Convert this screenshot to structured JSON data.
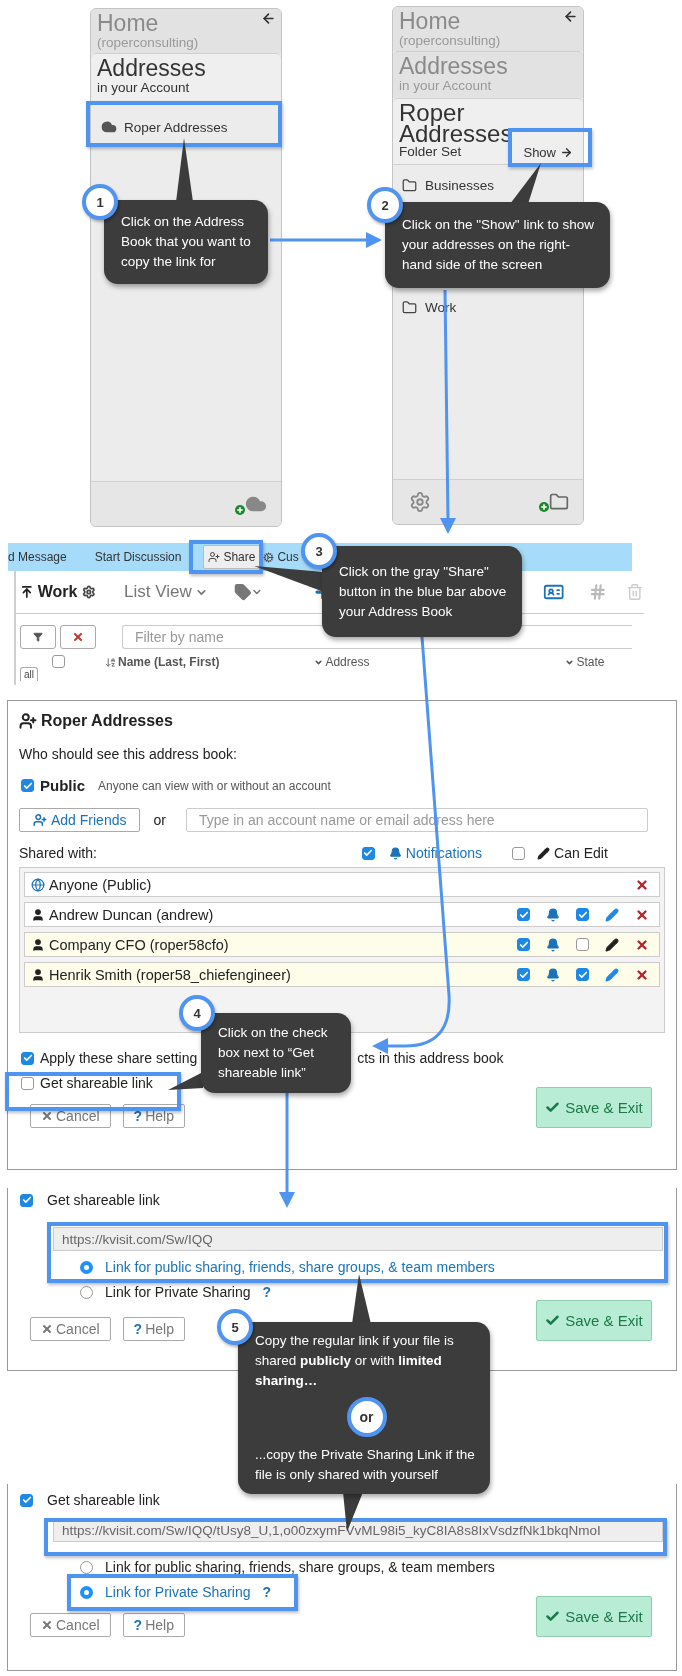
{
  "left_panel": {
    "home": {
      "title": "Home",
      "subtitle": "(roperconsulting)"
    },
    "account": {
      "title": "Addresses",
      "subtitle": "in your Account",
      "active": true
    },
    "items": [
      {
        "label": "Roper Addresses"
      }
    ]
  },
  "right_panel": {
    "home": {
      "title": "Home",
      "subtitle": "(roperconsulting)"
    },
    "account": {
      "title": "Addresses",
      "subtitle": "in your Account",
      "active": false
    },
    "folder_set": {
      "title": "Roper Addresses",
      "subtitle": "Folder Set",
      "show_link": "Show"
    },
    "folders": [
      {
        "label": "Businesses"
      },
      {
        "label": "Work"
      }
    ]
  },
  "app_strip": {
    "menu": [
      {
        "label": "d Message",
        "kind": "link"
      },
      {
        "label": "Start Discussion",
        "kind": "link"
      },
      {
        "label": "Share",
        "kind": "button"
      },
      {
        "label": "Cus",
        "kind": "icon-link"
      }
    ],
    "folder_title": "Work",
    "view_menu": "List View",
    "filter": {
      "placeholder": "Filter by name"
    },
    "all_tab": "all",
    "select_all": {
      "checked": false
    },
    "columns": [
      "Name (Last, First)",
      "Address",
      "State"
    ]
  },
  "share_dialog": {
    "title": "Roper Addresses",
    "prompt": "Who should see this address book:",
    "public": {
      "checked": true,
      "label": "Public",
      "description": "Anyone can view with or without an account"
    },
    "add_friends": "Add Friends",
    "or": "or",
    "account_field": {
      "placeholder": "Type in an account name or email address here"
    },
    "shared_with": "Shared with:",
    "notifications": {
      "checked": true,
      "label": "Notifications"
    },
    "can_edit": {
      "checked": false,
      "label": "Can Edit"
    },
    "members": [
      {
        "name": "Anyone (Public)",
        "kind": "public",
        "highlighted": false
      },
      {
        "name": "Andrew Duncan (andrew)",
        "kind": "person",
        "highlighted": false,
        "notify": true,
        "edit": true
      },
      {
        "name": "Company CFO (roper58cfo)",
        "kind": "person",
        "highlighted": true,
        "notify": true,
        "edit": false
      },
      {
        "name": "Henrik Smith (roper58_chiefengineer)",
        "kind": "person",
        "highlighted": true,
        "notify": true,
        "edit": true
      }
    ],
    "apply": {
      "checked": true,
      "label_start": "Apply these share setting",
      "label_end": "cts in this address book"
    },
    "shareable": {
      "checked": false,
      "label": "Get shareable link"
    },
    "buttons": {
      "cancel": "Cancel",
      "help_mark": "?",
      "help": "Help",
      "save": "Save & Exit"
    }
  },
  "link_dialogs": [
    {
      "shareable": {
        "checked": true,
        "label": "Get shareable link"
      },
      "url": "https://kvisit.com/Sw/IQQ",
      "options": [
        {
          "label": "Link for public sharing, friends, share groups, & team members",
          "selected": true
        },
        {
          "label": "Link for Private Sharing",
          "selected": false,
          "help_mark": "?"
        }
      ],
      "buttons": {
        "cancel": "Cancel",
        "help_mark": "?",
        "help": "Help",
        "save": "Save & Exit"
      }
    },
    {
      "shareable": {
        "checked": true,
        "label": "Get shareable link"
      },
      "url": "https://kvisit.com/Sw/IQQ/tUsy8_U,1,o00zxymFVvML98i5_kyC8IA8s8IxVsdzfNk1bkqNmoI",
      "options": [
        {
          "label": "Link for public sharing, friends, share groups, & team members",
          "selected": false
        },
        {
          "label": "Link for Private Sharing",
          "selected": true,
          "help_mark": "?"
        }
      ],
      "buttons": {
        "cancel": "Cancel",
        "help_mark": "?",
        "help": "Help",
        "save": "Save & Exit"
      }
    }
  ],
  "callouts": [
    {
      "number": "1",
      "text": "Click on the Address Book that you want to copy the link for"
    },
    {
      "number": "2",
      "text": "Click on the \"Show\" link to show your addresses on the right-hand side of the screen"
    },
    {
      "number": "3",
      "text": "Click on the gray \"Share\" button in the blue bar above your Address Book"
    },
    {
      "number": "4",
      "text": "Click on the check box next to “Get shareable link”"
    },
    {
      "number": "5",
      "text": "Copy the regular link if your file is shared **publicly** or with **limited sharing…**",
      "or": "or",
      "text_after": "...copy the Private Sharing Link if the file is only shared with yourself"
    }
  ]
}
